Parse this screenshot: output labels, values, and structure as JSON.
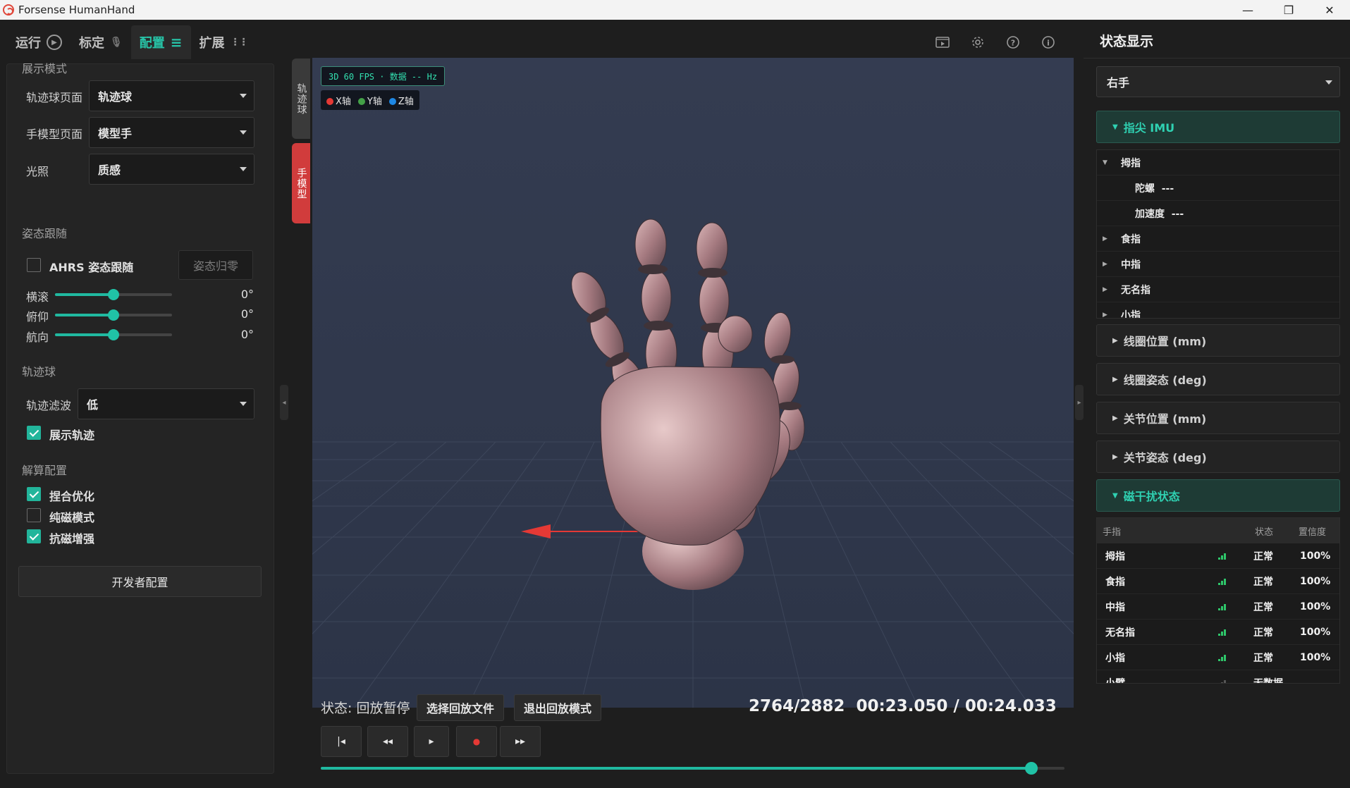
{
  "window": {
    "title": "Forsense HumanHand",
    "minimize": "—",
    "maximize": "❐",
    "close": "✕"
  },
  "tabs": [
    {
      "label": "运行",
      "icon": "▶"
    },
    {
      "label": "标定",
      "icon": "🎙"
    },
    {
      "label": "配置",
      "icon": "≡"
    },
    {
      "label": "扩展",
      "icon": "⋮⋮"
    }
  ],
  "display_mode": {
    "title": "展示模式",
    "rows": [
      {
        "label": "轨迹球页面",
        "value": "轨迹球"
      },
      {
        "label": "手模型页面",
        "value": "模型手"
      },
      {
        "label": "光照",
        "value": "质感"
      }
    ]
  },
  "pose_follow": {
    "title": "姿态跟随",
    "ahrs_label": "AHRS 姿态跟随",
    "ahrs_checked": false,
    "reset_label": "姿态归零",
    "sliders": [
      {
        "label": "横滚",
        "value": "0°",
        "level": 0.5
      },
      {
        "label": "俯仰",
        "value": "0°",
        "level": 0.5
      },
      {
        "label": "航向",
        "value": "0°",
        "level": 0.5
      }
    ]
  },
  "trackball": {
    "title": "轨迹球",
    "filter_label": "轨迹滤波",
    "filter_value": "低",
    "show_trail_label": "展示轨迹",
    "show_trail_checked": true
  },
  "solver": {
    "title": "解算配置",
    "options": [
      {
        "label": "捏合优化",
        "checked": true
      },
      {
        "label": "纯磁模式",
        "checked": false
      },
      {
        "label": "抗磁增强",
        "checked": true
      }
    ],
    "dev_button": "开发者配置"
  },
  "viewport": {
    "side_tabs": [
      {
        "label": "轨迹球",
        "active": false
      },
      {
        "label": "手模型",
        "active": true
      }
    ],
    "hud_fps": "3D 60 FPS · 数据 -- Hz",
    "axes": [
      {
        "label": "X轴",
        "color": "#e53935"
      },
      {
        "label": "Y轴",
        "color": "#43a047"
      },
      {
        "label": "Z轴",
        "color": "#1e88e5"
      }
    ],
    "toolbar_icons": [
      "video-icon",
      "gear-icon",
      "help-icon",
      "info-icon"
    ]
  },
  "playback": {
    "status": "状态: 回放暂停",
    "select_file": "选择回放文件",
    "exit_mode": "退出回放模式",
    "frame_info": "2764/2882  00:23.050 / 00:24.033",
    "progress": 0.955,
    "controls": [
      "|◂",
      "◂◂",
      "▸",
      "●",
      "▸▸"
    ]
  },
  "status_panel": {
    "title": "状态显示",
    "hand": "右手",
    "imu_section": "指尖 IMU",
    "imu_tree": [
      {
        "label": "拇指",
        "expanded": true,
        "level": 0
      },
      {
        "label": "陀螺  ---",
        "level": 1
      },
      {
        "label": "加速度  ---",
        "level": 1
      },
      {
        "label": "食指",
        "expanded": false,
        "level": 0
      },
      {
        "label": "中指",
        "expanded": false,
        "level": 0
      },
      {
        "label": "无名指",
        "expanded": false,
        "level": 0
      },
      {
        "label": "小指",
        "expanded": false,
        "level": 0
      }
    ],
    "sections": [
      "线圈位置 (mm)",
      "线圈姿态 (deg)",
      "关节位置 (mm)",
      "关节姿态 (deg)"
    ],
    "interference_section": "磁干扰状态",
    "table": {
      "headers": [
        "手指",
        "状态",
        "置信度"
      ],
      "rows": [
        {
          "finger": "拇指",
          "state": "正常",
          "confidence": "100%"
        },
        {
          "finger": "食指",
          "state": "正常",
          "confidence": "100%"
        },
        {
          "finger": "中指",
          "state": "正常",
          "confidence": "100%"
        },
        {
          "finger": "无名指",
          "state": "正常",
          "confidence": "100%"
        },
        {
          "finger": "小指",
          "state": "正常",
          "confidence": "100%"
        },
        {
          "finger": "小臂",
          "state": "无数据",
          "confidence": ""
        }
      ]
    }
  }
}
